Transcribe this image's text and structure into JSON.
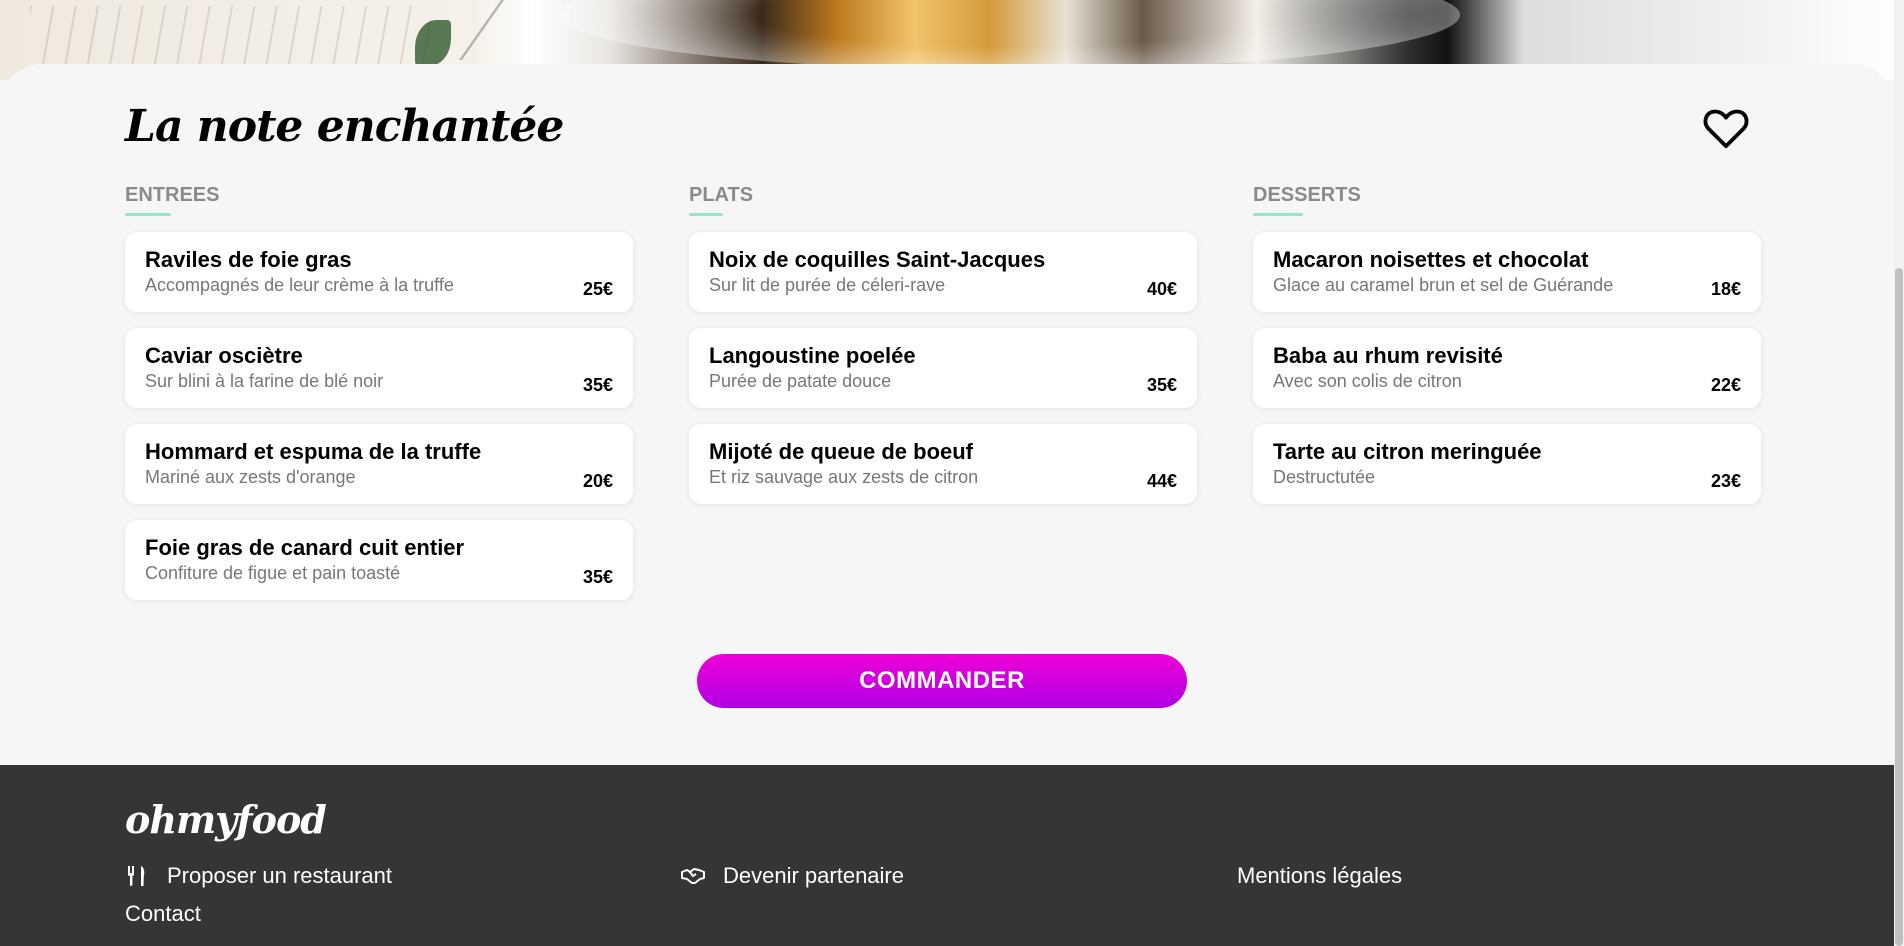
{
  "restaurant": {
    "title": "La note enchantée"
  },
  "menu": {
    "columns": [
      {
        "heading": "ENTREES",
        "dishes": [
          {
            "name": "Raviles de foie gras",
            "desc": "Accompagnés de leur crème à la truffe",
            "price": "25€"
          },
          {
            "name": "Caviar osciètre",
            "desc": "Sur blini à la farine de blé noir",
            "price": "35€"
          },
          {
            "name": "Hommard et espuma de la truffe",
            "desc": "Mariné aux zests d'orange",
            "price": "20€"
          },
          {
            "name": "Foie gras de canard cuit entier",
            "desc": "Confiture de figue et pain toasté",
            "price": "35€"
          }
        ]
      },
      {
        "heading": "PLATS",
        "dishes": [
          {
            "name": "Noix de coquilles Saint-Jacques",
            "desc": "Sur lit de purée de céleri-rave",
            "price": "40€"
          },
          {
            "name": "Langoustine poelée",
            "desc": "Purée de patate douce",
            "price": "35€"
          },
          {
            "name": "Mijoté de queue de boeuf",
            "desc": "Et riz sauvage aux zests de citron",
            "price": "44€"
          }
        ]
      },
      {
        "heading": "DESSERTS",
        "dishes": [
          {
            "name": "Macaron noisettes et chocolat",
            "desc": "Glace au caramel brun et sel de Guérande",
            "price": "18€"
          },
          {
            "name": "Baba au rhum revisité",
            "desc": "Avec son colis de citron",
            "price": "22€"
          },
          {
            "name": "Tarte au citron meringuée",
            "desc": "Destructutée",
            "price": "23€"
          }
        ]
      }
    ],
    "order_button": "COMMANDER"
  },
  "footer": {
    "logo": "ohmyfood",
    "links": {
      "propose": "Proposer un restaurant",
      "partner": "Devenir partenaire",
      "legal": "Mentions légales",
      "contact": "Contact"
    }
  },
  "icons": {
    "heart": "heart-icon",
    "utensils": "utensils-icon",
    "handshake": "handshake-icon"
  },
  "colors": {
    "accent_underline": "#99e2d0",
    "button_gradient_start": "#ee00d8",
    "button_gradient_end": "#b000e4",
    "footer_bg": "#353535"
  }
}
